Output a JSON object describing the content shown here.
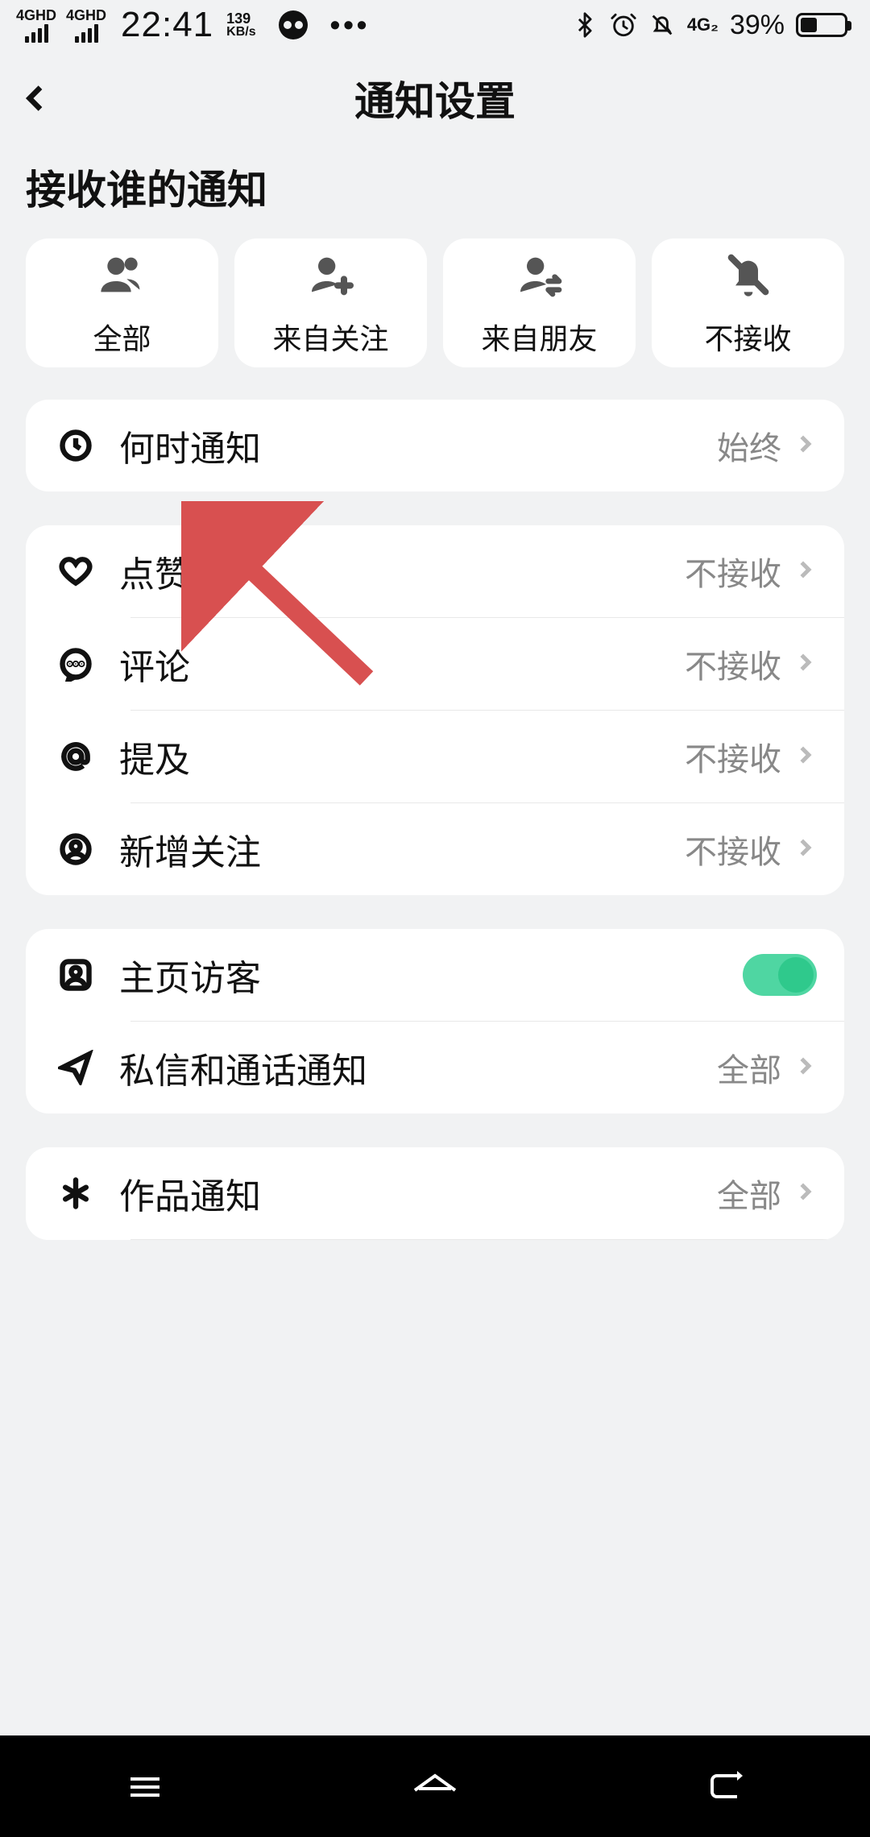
{
  "status": {
    "sig1": "4GHD",
    "sig2": "4GHD",
    "time": "22:41",
    "net_speed_value": "139",
    "net_speed_unit": "KB/s",
    "net_label": "4G₂",
    "battery_pct": "39%"
  },
  "header": {
    "title": "通知设置"
  },
  "section_heading": "接收谁的通知",
  "sources": {
    "all": "全部",
    "from_follow": "来自关注",
    "from_friends": "来自朋友",
    "none": "不接收"
  },
  "rows": {
    "when": {
      "label": "何时通知",
      "value": "始终"
    },
    "like": {
      "label": "点赞",
      "value": "不接收"
    },
    "comment": {
      "label": "评论",
      "value": "不接收"
    },
    "mention": {
      "label": "提及",
      "value": "不接收"
    },
    "new_follow": {
      "label": "新增关注",
      "value": "不接收"
    },
    "visitor": {
      "label": "主页访客"
    },
    "dm": {
      "label": "私信和通话通知",
      "value": "全部"
    },
    "works": {
      "label": "作品通知",
      "value": "全部"
    }
  },
  "toggles": {
    "visitor_on": true
  }
}
